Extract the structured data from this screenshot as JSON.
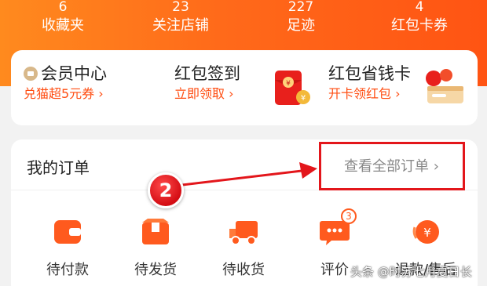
{
  "stats": [
    {
      "num": "6",
      "label": "收藏夹"
    },
    {
      "num": "23",
      "label": "关注店铺"
    },
    {
      "num": "227",
      "label": "足迹"
    },
    {
      "num": "4",
      "label": "红包卡券"
    }
  ],
  "perks": {
    "member": {
      "title": "会员中心",
      "sub": "兑猫超5元券 ›"
    },
    "redpacket_signin": {
      "title": "红包签到",
      "sub": "立即领取 ›"
    },
    "savings_card": {
      "title": "红包省钱卡",
      "sub": "开卡领红包 ›"
    }
  },
  "orders": {
    "title": "我的订单",
    "view_all": "查看全部订单 ›",
    "items": [
      {
        "label": "待付款",
        "icon": "wallet-icon"
      },
      {
        "label": "待发货",
        "icon": "box-icon"
      },
      {
        "label": "待收货",
        "icon": "truck-icon"
      },
      {
        "label": "评价",
        "icon": "chat-icon",
        "badge": "3"
      },
      {
        "label": "退款/售后",
        "icon": "refund-icon"
      }
    ]
  },
  "annotation": {
    "step": "2",
    "color": "#e3161b"
  },
  "watermark": "头条 @时苏七月夏日长",
  "colors": {
    "accent": "#ff5a1e",
    "header": "#ff6a1a"
  }
}
